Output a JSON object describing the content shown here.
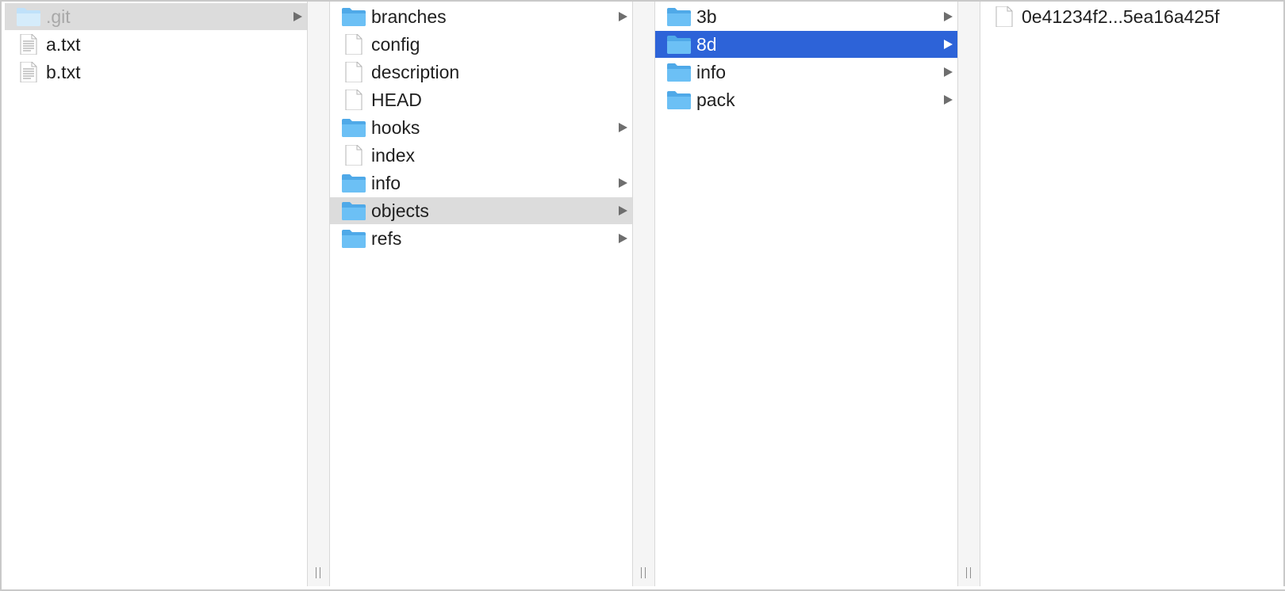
{
  "columns": [
    {
      "items": [
        {
          "label": ".git",
          "kind": "folder",
          "has_arrow": true,
          "state": "selected-gray",
          "dim": true
        },
        {
          "label": "a.txt",
          "kind": "text-file",
          "has_arrow": false
        },
        {
          "label": "b.txt",
          "kind": "text-file",
          "has_arrow": false
        }
      ]
    },
    {
      "items": [
        {
          "label": "branches",
          "kind": "folder",
          "has_arrow": true
        },
        {
          "label": "config",
          "kind": "file",
          "has_arrow": false
        },
        {
          "label": "description",
          "kind": "file",
          "has_arrow": false
        },
        {
          "label": "HEAD",
          "kind": "file",
          "has_arrow": false
        },
        {
          "label": "hooks",
          "kind": "folder",
          "has_arrow": true
        },
        {
          "label": "index",
          "kind": "file",
          "has_arrow": false
        },
        {
          "label": "info",
          "kind": "folder",
          "has_arrow": true
        },
        {
          "label": "objects",
          "kind": "folder",
          "has_arrow": true,
          "state": "selected-gray"
        },
        {
          "label": "refs",
          "kind": "folder",
          "has_arrow": true
        }
      ]
    },
    {
      "items": [
        {
          "label": "3b",
          "kind": "folder",
          "has_arrow": true
        },
        {
          "label": "8d",
          "kind": "folder",
          "has_arrow": true,
          "state": "selected-blue"
        },
        {
          "label": "info",
          "kind": "folder",
          "has_arrow": true
        },
        {
          "label": "pack",
          "kind": "folder",
          "has_arrow": true
        }
      ]
    },
    {
      "items": [
        {
          "label": "0e41234f2...5ea16a425f",
          "kind": "file",
          "has_arrow": false
        }
      ]
    }
  ],
  "colors": {
    "selection_blue": "#2d63d8",
    "selection_gray": "#dcdcdc",
    "folder_blue": "#6cc0f5"
  }
}
